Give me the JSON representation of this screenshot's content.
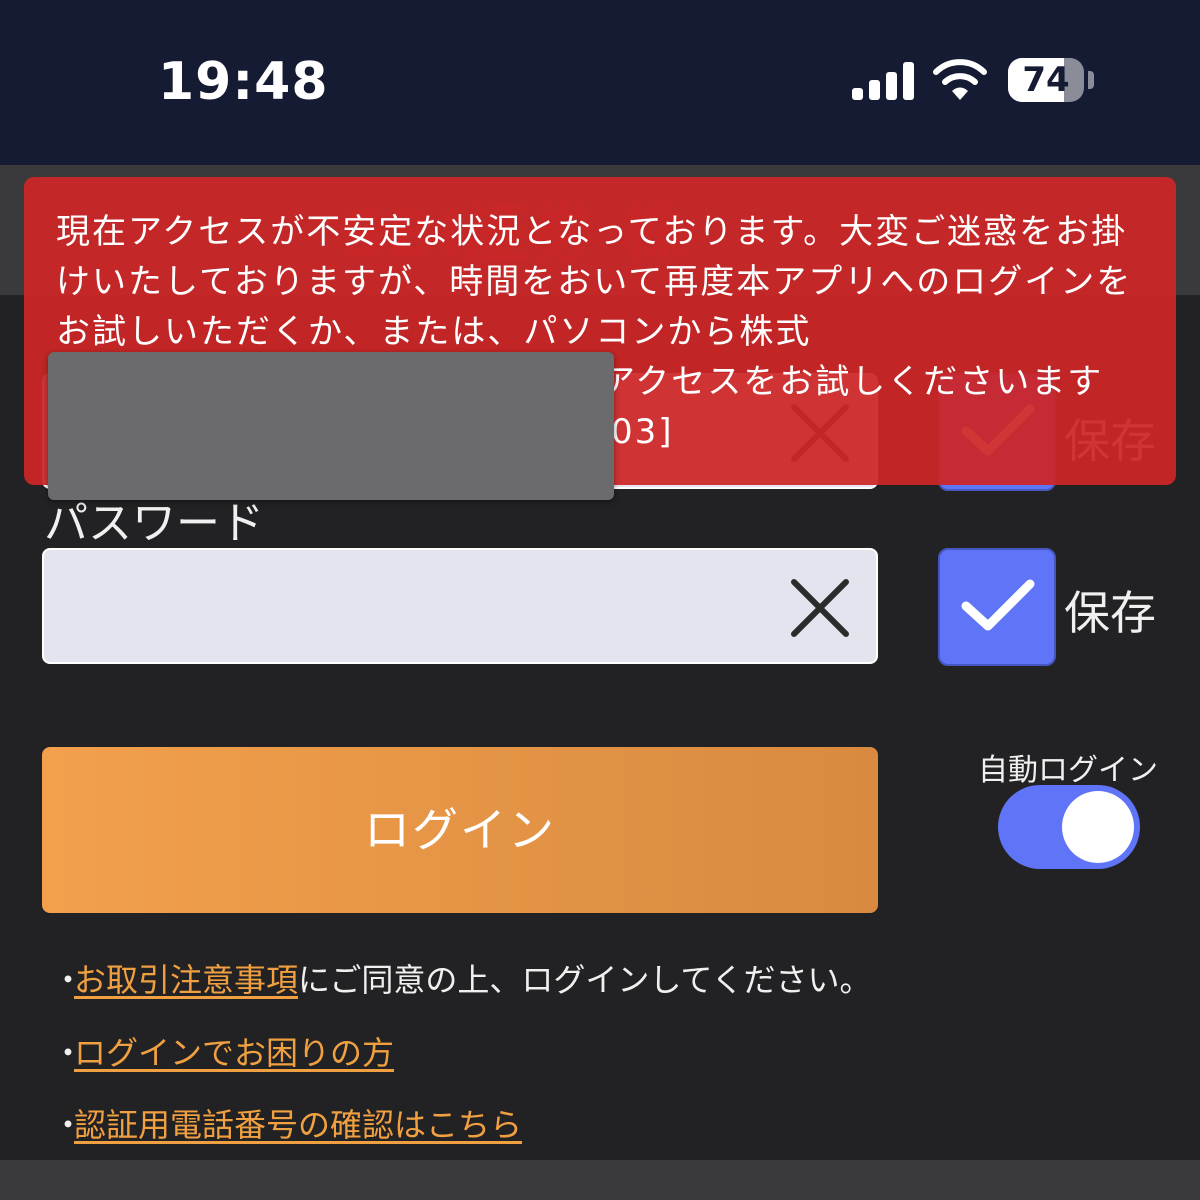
{
  "status_bar": {
    "time": "19:48",
    "battery_level": "74",
    "battery_fraction": 0.74,
    "icons": [
      "cellular-signal-icon",
      "wifi-icon",
      "battery-icon"
    ]
  },
  "app": {
    "password_label": "パスワード",
    "save_label": "保存",
    "save_label_2": "保存",
    "login_button": "ログイン",
    "auto_login_label": "自動ログイン",
    "auto_login_on": true,
    "notes": {
      "terms_link": "お取引注意事項",
      "terms_suffix": "にご同意の上、ログインしてください。",
      "help_link": "ログインでお困りの方",
      "phone_link": "認証用電話番号の確認はこちら",
      "bullet": "・"
    }
  },
  "error_banner": {
    "message": "現在アクセスが不安定な状況となっております。大変ご迷惑をお掛けいたしておりますが、時間をおいて再度本アプリへのログインをお試しいただくか、または、パソコンから株式",
    "message_tail": "アクセスをお試しくださいます",
    "code_tail": "03]"
  },
  "colors": {
    "status_bar_bg": "#161b34",
    "app_bg": "#222224",
    "error_red": "#cd2626",
    "accent_blue": "#5f74f6",
    "login_orange": "#f2a04c",
    "link_orange": "#f0a040"
  }
}
